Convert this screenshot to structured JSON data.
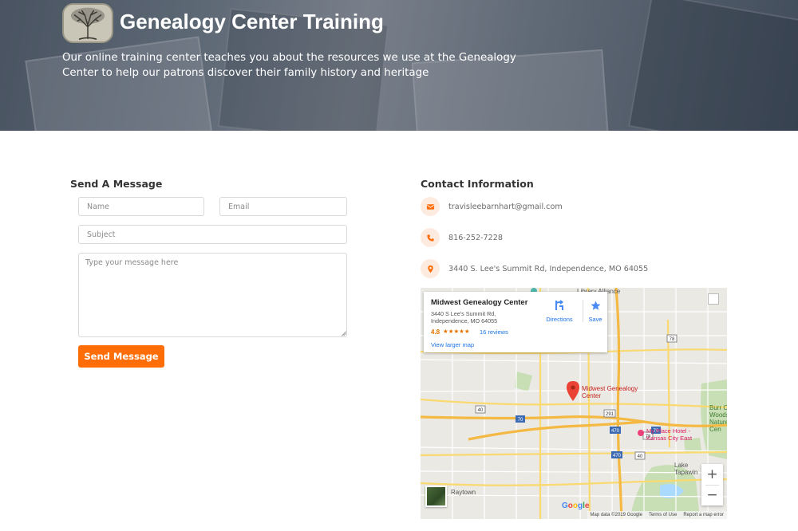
{
  "header": {
    "title": "Genealogy Center Training",
    "tagline": "Our online training center teaches you about the resources we use at the Genealogy Center to help our patrons discover their family history and heritage",
    "logo_icon": "tree-icon"
  },
  "form": {
    "heading": "Send A Message",
    "name_placeholder": "Name",
    "email_placeholder": "Email",
    "subject_placeholder": "Subject",
    "message_placeholder": "Type your message here",
    "submit_label": "Send Message",
    "accent_color": "#ff6d07"
  },
  "contact": {
    "heading": "Contact Information",
    "email": "travisleebarnhart@gmail.com",
    "phone": "816-252-7228",
    "address": "3440 S. Lee's Summit Rd, Independence, MO 64055",
    "icons": [
      "envelope-icon",
      "phone-icon",
      "map-pin-icon"
    ]
  },
  "map": {
    "card": {
      "title": "Midwest Genealogy Center",
      "address": "3440 S Lee's Summit Rd, Independence, MO 64055",
      "rating": "4.8",
      "stars": "★★★★★",
      "reviews": "16 reviews",
      "directions_label": "Directions",
      "save_label": "Save",
      "larger_map_label": "View larger map"
    },
    "labels": {
      "library": "Library Alliance",
      "marker": "Midwest Genealogy Center",
      "hotel": "My Place Hotel - Kansas City East",
      "raytown": "Raytown",
      "lake": "Lake Tapawin",
      "burr": "Burr Oak Woods Nature Cen"
    },
    "shields": [
      "78",
      "40",
      "70",
      "291",
      "470",
      "40",
      "78",
      "470",
      "70"
    ],
    "zoom_in": "+",
    "zoom_out": "−",
    "google": "Google",
    "attribution": [
      "Map data ©2019 Google",
      "Terms of Use",
      "Report a map error"
    ]
  }
}
